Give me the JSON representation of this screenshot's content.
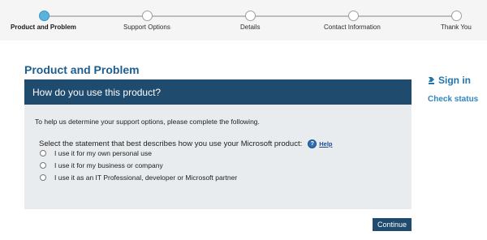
{
  "progress": {
    "steps": [
      {
        "label": "Product and Problem",
        "active": true
      },
      {
        "label": "Support Options",
        "active": false
      },
      {
        "label": "Details",
        "active": false
      },
      {
        "label": "Contact Information",
        "active": false
      },
      {
        "label": "Thank You",
        "active": false
      }
    ]
  },
  "page": {
    "title": "Product and Problem"
  },
  "sidebar": {
    "sign_in": "Sign in",
    "check_status": "Check status"
  },
  "panel": {
    "header": "How do you use this product?",
    "instructions": "To help us determine your support options, please complete the following.",
    "question": "Select the statement that best describes how you use your Microsoft product:",
    "help_label": "Help",
    "options": [
      "I use it for my own personal use",
      "I use it for my business or company",
      "I use it as an IT Professional, developer or Microsoft partner"
    ]
  },
  "actions": {
    "continue": "Continue"
  },
  "colors": {
    "header_bg": "#1f4b6f",
    "title": "#1f5f8f",
    "active_step": "#58b3dd",
    "panel_bg": "#e9ecee"
  }
}
